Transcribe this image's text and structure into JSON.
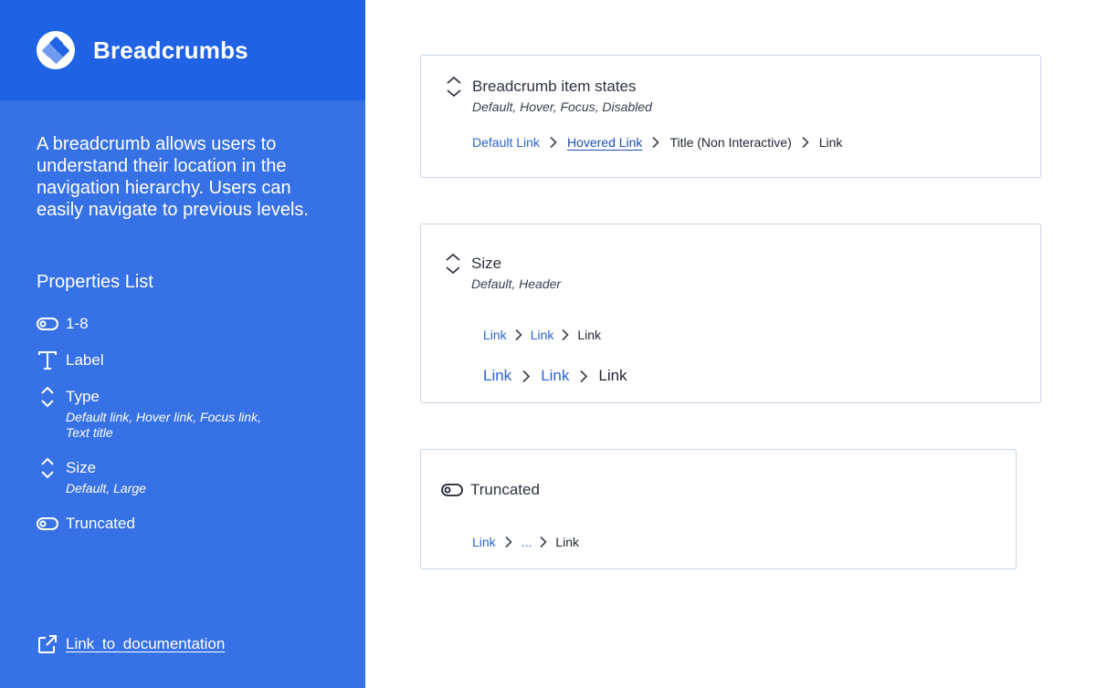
{
  "sidebar": {
    "title": "Breadcrumbs",
    "description": "A breadcrumb allows users to understand their location in the navigation hierarchy. Users can easily navigate to previous levels.",
    "properties_heading": "Properties List",
    "properties": [
      {
        "icon": "toggle-icon",
        "label": "1-8",
        "sub": ""
      },
      {
        "icon": "text-icon",
        "label": "Label",
        "sub": ""
      },
      {
        "icon": "chevron-up-down-icon",
        "label": "Type",
        "sub": "Default link, Hover link, Focus link, Text title"
      },
      {
        "icon": "chevron-up-down-icon",
        "label": "Size",
        "sub": "Default, Large"
      },
      {
        "icon": "toggle-icon",
        "label": "Truncated",
        "sub": ""
      }
    ],
    "doc_link": "Link to documentation"
  },
  "cards": {
    "states": {
      "title": "Breadcrumb item states",
      "subtitle": "Default, Hover, Focus, Disabled",
      "crumbs": [
        "Default Link",
        "Hovered Link",
        "Title (Non Interactive)",
        "Link"
      ]
    },
    "size": {
      "title": "Size",
      "subtitle": "Default, Header",
      "small_crumbs": [
        "Link",
        "Link",
        "Link"
      ],
      "large_crumbs": [
        "Link",
        "Link",
        "Link"
      ]
    },
    "truncated": {
      "title": "Truncated",
      "crumbs": [
        "Link",
        "...",
        "Link"
      ]
    }
  },
  "colors": {
    "sidebar_bg": "#3771e6",
    "sidebar_header_bg": "#1f62e3",
    "link": "#2a63d8",
    "card_border": "#c7d3e6"
  }
}
